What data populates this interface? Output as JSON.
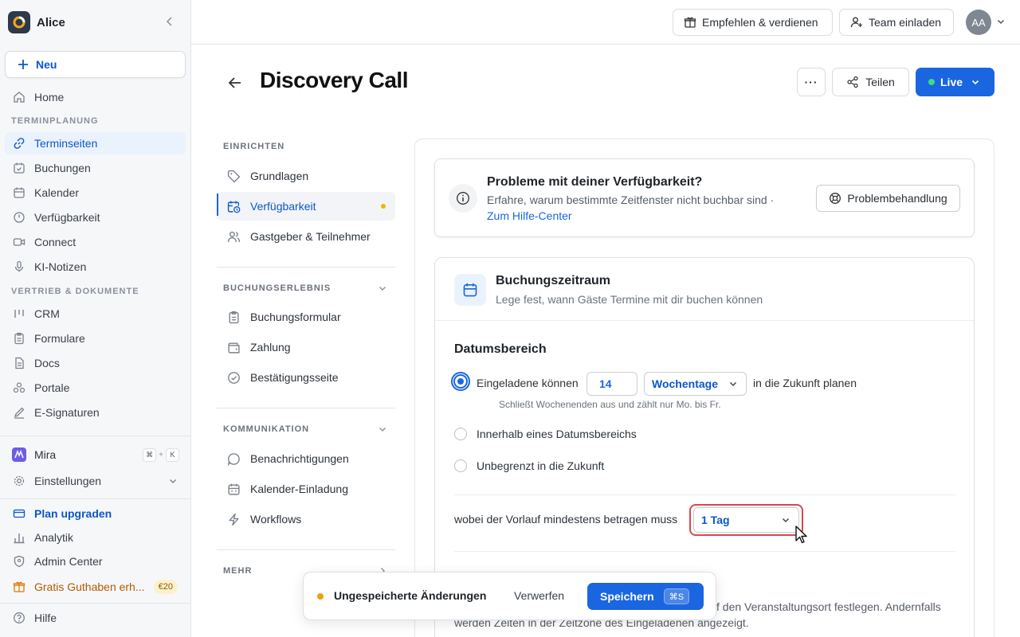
{
  "workspace": {
    "name": "Alice"
  },
  "sidebar": {
    "new_label": "Neu",
    "home": "Home",
    "section_scheduling": "TERMINPLANUNG",
    "scheduling_items": [
      {
        "label": "Terminseiten",
        "icon": "link-icon"
      },
      {
        "label": "Buchungen",
        "icon": "calendar-check-icon"
      },
      {
        "label": "Kalender",
        "icon": "calendar-icon"
      },
      {
        "label": "Verfügbarkeit",
        "icon": "clock-icon"
      },
      {
        "label": "Connect",
        "icon": "video-icon"
      },
      {
        "label": "KI-Notizen",
        "icon": "mic-icon"
      }
    ],
    "section_sales": "VERTRIEB & DOKUMENTE",
    "sales_items": [
      {
        "label": "CRM",
        "icon": "crm-icon"
      },
      {
        "label": "Formulare",
        "icon": "clipboard-icon"
      },
      {
        "label": "Docs",
        "icon": "doc-icon"
      },
      {
        "label": "Portale",
        "icon": "portal-icon"
      },
      {
        "label": "E-Signaturen",
        "icon": "pen-icon"
      }
    ],
    "mira": "Mira",
    "mira_kbd": [
      "⌘",
      "+",
      "K"
    ],
    "settings": "Einstellungen",
    "upgrade": "Plan upgraden",
    "analytics": "Analytik",
    "admin": "Admin Center",
    "credit": "Gratis Guthaben erh...",
    "credit_badge": "€20",
    "help": "Hilfe"
  },
  "topbar": {
    "refer_label": "Empfehlen & verdienen",
    "invite_label": "Team einladen",
    "avatar_initials": "AA"
  },
  "header": {
    "title": "Discovery Call",
    "more_label": "···",
    "share_label": "Teilen",
    "live_label": "Live"
  },
  "subnav": {
    "setup_label": "EINRICHTEN",
    "setup_items": [
      "Grundlagen",
      "Verfügbarkeit",
      "Gastgeber & Teilnehmer"
    ],
    "booking_label": "BUCHUNGSERLEBNIS",
    "booking_items": [
      "Buchungsformular",
      "Zahlung",
      "Bestätigungsseite"
    ],
    "comm_label": "KOMMUNIKATION",
    "comm_items": [
      "Benachrichtigungen",
      "Kalender-Einladung",
      "Workflows"
    ],
    "more_label": "MEHR"
  },
  "alert": {
    "title": "Probleme mit deiner Verfügbarkeit?",
    "text": "Erfahre, warum bestimmte Zeitfenster nicht buchbar sind ·",
    "link": "Zum Hilfe-Center",
    "button": "Problembehandlung"
  },
  "booking_window": {
    "title": "Buchungszeitraum",
    "subtitle": "Lege fest, wann Gäste Termine mit dir buchen können",
    "date_range_title": "Datumsbereich",
    "option1_prefix": "Eingeladene können",
    "days_value": "14",
    "days_unit": "Wochentage",
    "option1_suffix": "in die Zukunft planen",
    "option1_hint": "Schließt Wochenenden aus und zählt nur Mo. bis Fr.",
    "option2": "Innerhalb eines Datumsbereichs",
    "option3": "Unbegrenzt in die Zukunft",
    "lead_label": "wobei der Vorlauf mindestens betragen muss",
    "lead_value": "1 Tag",
    "timezone_text_1": "f den Veranstaltungsort festlegen. Andernfalls",
    "timezone_text_2": "werden Zeiten in der Zeitzone des Eingeladenen angezeigt."
  },
  "toast": {
    "text": "Ungespeicherte Änderungen",
    "discard": "Verwerfen",
    "save": "Speichern",
    "save_kbd": "⌘S"
  },
  "colors": {
    "accent": "#1a66e0",
    "live_dot": "#3ddc84",
    "unsaved_dot": "#f59e0b",
    "focus_ring": "#e0444f"
  }
}
